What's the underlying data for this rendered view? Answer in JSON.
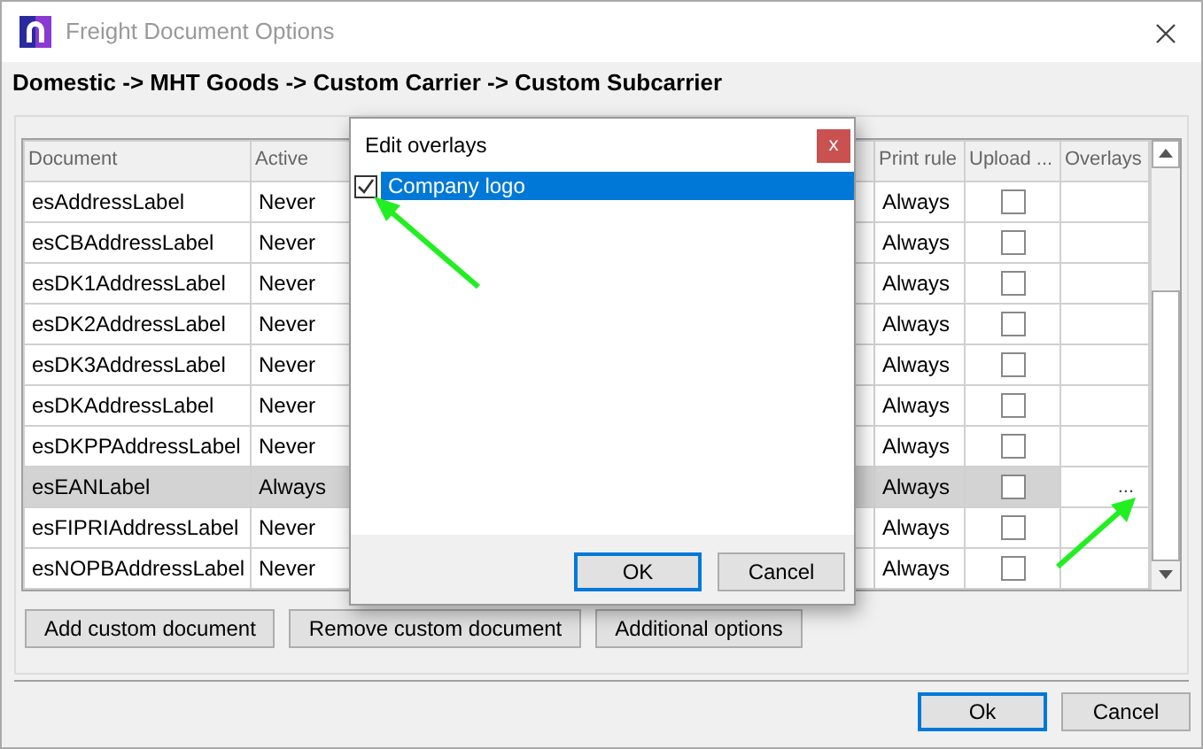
{
  "window": {
    "title": "Freight Document Options"
  },
  "breadcrumb": "Domestic -> MHT Goods -> Custom Carrier -> Custom Subcarrier",
  "table": {
    "columns": [
      "Document",
      "Active",
      "Print rule",
      "Upload ...",
      "Overlays"
    ],
    "rows": [
      {
        "document": "esAddressLabel",
        "active": "Never",
        "print_rule": "Always",
        "upload": false,
        "selected": false
      },
      {
        "document": "esCBAddressLabel",
        "active": "Never",
        "print_rule": "Always",
        "upload": false,
        "selected": false
      },
      {
        "document": "esDK1AddressLabel",
        "active": "Never",
        "print_rule": "Always",
        "upload": false,
        "selected": false
      },
      {
        "document": "esDK2AddressLabel",
        "active": "Never",
        "print_rule": "Always",
        "upload": false,
        "selected": false
      },
      {
        "document": "esDK3AddressLabel",
        "active": "Never",
        "print_rule": "Always",
        "upload": false,
        "selected": false
      },
      {
        "document": "esDKAddressLabel",
        "active": "Never",
        "print_rule": "Always",
        "upload": false,
        "selected": false
      },
      {
        "document": "esDKPPAddressLabel",
        "active": "Never",
        "print_rule": "Always",
        "upload": false,
        "selected": false
      },
      {
        "document": "esEANLabel",
        "active": "Always",
        "print_rule": "Always",
        "upload": false,
        "selected": true,
        "overlays_button": "..."
      },
      {
        "document": "esFIPRIAddressLabel",
        "active": "Never",
        "print_rule": "Always",
        "upload": false,
        "selected": false
      },
      {
        "document": "esNOPBAddressLabel",
        "active": "Never",
        "print_rule": "Always",
        "upload": false,
        "selected": false
      }
    ]
  },
  "actions": [
    "Add custom document",
    "Remove custom document",
    "Additional options"
  ],
  "footer_buttons": [
    {
      "label": "Ok",
      "default": true
    },
    {
      "label": "Cancel",
      "default": false
    }
  ],
  "dialog": {
    "title": "Edit overlays",
    "close": "x",
    "items": [
      {
        "label": "Company logo",
        "checked": true,
        "selected": true
      }
    ],
    "buttons": [
      {
        "label": "OK",
        "default": true
      },
      {
        "label": "Cancel",
        "default": false
      }
    ]
  }
}
